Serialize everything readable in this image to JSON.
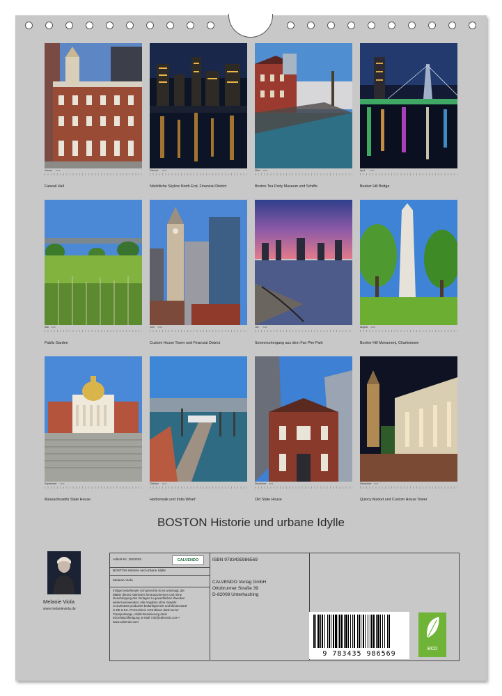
{
  "months": [
    {
      "name": "Januar",
      "year": "2026",
      "caption": "Faneuil Hall"
    },
    {
      "name": "Februar",
      "year": "2026",
      "caption": "Nächtliche Skyline North End, Financial District"
    },
    {
      "name": "März",
      "year": "2026",
      "caption": "Boston Tea Party Museum und Schiffe"
    },
    {
      "name": "April",
      "year": "2026",
      "caption": "Bunker Hill Bridge"
    },
    {
      "name": "Mai",
      "year": "2026",
      "caption": "Public Garden"
    },
    {
      "name": "Juni",
      "year": "2026",
      "caption": "Custom House Tower und Financial District"
    },
    {
      "name": "Juli",
      "year": "2026",
      "caption": "Sonnenuntergang aus dem Fan Pier Park"
    },
    {
      "name": "August",
      "year": "2026",
      "caption": "Bunker Hill Monument, Charlestown"
    },
    {
      "name": "September",
      "year": "2026",
      "caption": "Massachusetts State House"
    },
    {
      "name": "Oktober",
      "year": "2026",
      "caption": "Harborwalk und India Wharf"
    },
    {
      "name": "November",
      "year": "2026",
      "caption": "Old State House"
    },
    {
      "name": "Dezember",
      "year": "2026",
      "caption": "Quincy Market und Custom House Tower"
    }
  ],
  "title": "BOSTON Historie und urbane Idylle",
  "author": {
    "name": "Melanie Viola",
    "website": "www.melanieviola.de"
  },
  "info": {
    "article": "Artikel-Nr. 1824303",
    "publisher_logo": "CALVENDO",
    "product_title": "BOSTON Historie und urbane Idylle",
    "author": "Melanie Viola",
    "legal": "Infolge bestehender Schutzrechte ist es untersagt, die Blätter dieses Kalenders herauszutrennen und ohne Genehmigung des Verlages zu gewerblichen Zwecken weiterzuverwenden. Alle Angaben ohne Gewähr. CALVENDO produziert bedarfsgerecht und klimaneutral in DE & EU. Prozessfreie CO2-Bilanz dank kurzer Transportwege, Abfall-Reduzierung dank Einzelstückfertigung. E-Mail: info@calvendo.com • www.calvendo.com",
    "isbn": "ISBN 9783435986569",
    "publisher_name": "CALVENDO Verlag GmbH",
    "street": "Ottobrunner Straße 39",
    "city": "D-82008 Unterhaching",
    "barcode_number": "9 783435 986569",
    "eco_label": "eco"
  },
  "colors": {
    "sheet": "#c8c8c8",
    "eco": "#6fb437"
  }
}
